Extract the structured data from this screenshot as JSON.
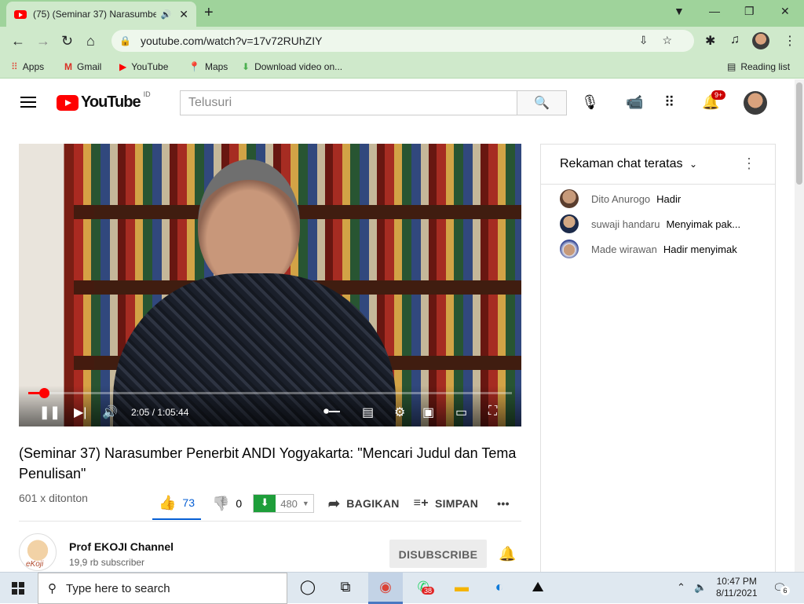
{
  "browser": {
    "tab_title": "(75) (Seminar 37) Narasumbe",
    "tab_close": "✕",
    "url": "youtube.com/watch?v=17v72RUhZIY",
    "bookmarks": [
      {
        "label": "Apps",
        "icon": "apps-grid-icon"
      },
      {
        "label": "Gmail",
        "icon": "gmail-icon"
      },
      {
        "label": "YouTube",
        "icon": "youtube-icon"
      },
      {
        "label": "Maps",
        "icon": "maps-icon"
      },
      {
        "label": "Download video on...",
        "icon": "download-icon"
      }
    ],
    "reading_list": "Reading list"
  },
  "youtube": {
    "logo_text": "YouTube",
    "country": "ID",
    "search_placeholder": "Telusuri",
    "notif_count": "9+"
  },
  "player": {
    "time": "2:05 / 1:05:44",
    "progress_fraction": 0.032
  },
  "video": {
    "title": "(Seminar 37) Narasumber Penerbit ANDI Yogyakarta: \"Mencari Judul dan Tema Penulisan\"",
    "views": "601 x ditonton",
    "likes": "73",
    "dislikes": "0",
    "download_count": "480",
    "share_label": "BAGIKAN",
    "save_label": "SIMPAN",
    "more_label": "•••"
  },
  "channel": {
    "name": "Prof EKOJI Channel",
    "subscribers": "19,9 rb subscriber",
    "unsubscribe_label": "DISUBSCRIBE",
    "avatar_caption": "eKoji"
  },
  "chat": {
    "header": "Rekaman chat teratas",
    "messages": [
      {
        "author": "Dito Anurogo",
        "text": "Hadir"
      },
      {
        "author": "suwaji handaru",
        "text": "Menyimak pak..."
      },
      {
        "author": "Made wirawan",
        "text": "Hadir menyimak"
      }
    ]
  },
  "taskbar": {
    "search_placeholder": "Type here to search",
    "whatsapp_badge": "38",
    "time": "10:47 PM",
    "date": "8/11/2021",
    "notification_count": "6"
  },
  "colors": {
    "chrome_frame": "#9fd39b",
    "chrome_toolbar": "#cfe9cb",
    "yt_red": "#ff0000",
    "like_blue": "#065fd4",
    "download_green": "#1e9e3a"
  }
}
